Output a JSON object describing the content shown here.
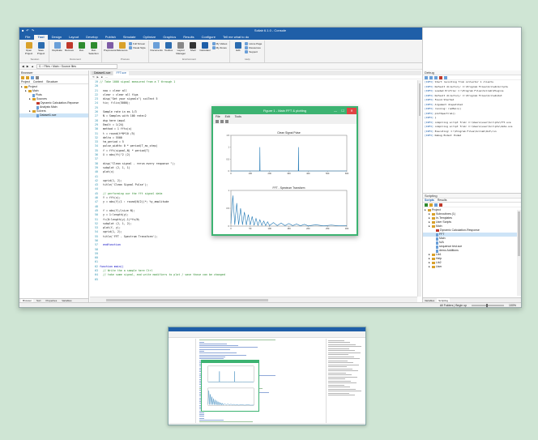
{
  "ide": {
    "title": "Scilab 6.1.0 - Console",
    "quick_access_icons": [
      "save-icon",
      "undo-icon",
      "redo-icon"
    ],
    "window_controls": [
      "—",
      "☐",
      "✕"
    ],
    "menu_tabs": [
      "File",
      "Design",
      "Layout",
      "Develop",
      "Publish",
      "Simulate",
      "Optimize",
      "Graphics",
      "Results",
      "Configure",
      "Tell me what to do"
    ],
    "active_tab": "Tool",
    "account": "Sign in",
    "ribbon": {
      "groups": [
        {
          "label": "Session",
          "buttons": [
            {
              "label": "Open Project",
              "color": "#d9a12b"
            },
            {
              "label": "Save Project",
              "color": "#2b6cb0"
            }
          ]
        },
        {
          "label": "Document",
          "buttons": [
            {
              "label": "Duplicate",
              "color": "#6a9fd8"
            },
            {
              "label": "Remove",
              "color": "#c0392b"
            },
            {
              "label": "Run",
              "color": "#2e8b2e"
            },
            {
              "label": "Run Selection",
              "color": "#2e8b2e"
            }
          ]
        },
        {
          "label": "Process",
          "buttons": [
            {
              "label": "Preprocess",
              "color": "#7d5ba6"
            },
            {
              "label": "Reference",
              "color": "#d9a12b"
            }
          ],
          "small": [
            "Full Screen",
            "Visual Style"
          ]
        },
        {
          "label": "Environment",
          "buttons": [
            {
              "label": "Documents",
              "color": "#6a9fd8"
            },
            {
              "label": "Toolbox",
              "color": "#2b6cb0"
            },
            {
              "label": "Layout Manager",
              "color": "#888888"
            },
            {
              "label": "Shell",
              "color": "#333333"
            },
            {
              "label": "Calculator",
              "color": "#1f5fa8"
            }
          ],
          "small": [
            "My Values",
            "My Zones"
          ]
        },
        {
          "label": "Help",
          "buttons": [
            {
              "label": "Edit",
              "color": "#2b6cb0"
            }
          ],
          "small": [
            "Home Page",
            "Resources",
            "Support"
          ]
        }
      ]
    },
    "address": "C: › Files › Main › Source files",
    "search_placeholder": "Search scripts",
    "browser": {
      "title": "Browser",
      "tabs": [
        "Project",
        "Content",
        "Structure"
      ],
      "tree": [
        {
          "label": "Project",
          "depth": 0,
          "kind": "folder"
        },
        {
          "label": "Main",
          "depth": 1,
          "kind": "folder"
        },
        {
          "label": "Plots",
          "depth": 2,
          "kind": "file"
        },
        {
          "label": "Sources",
          "depth": 2,
          "kind": "folder"
        },
        {
          "label": "Dynamic Calculation-Reponse",
          "depth": 3,
          "kind": "red"
        },
        {
          "label": "Analysis Main",
          "depth": 3,
          "kind": "file"
        },
        {
          "label": "Solvers",
          "depth": 2,
          "kind": "folder"
        },
        {
          "label": "Dataset1.sce",
          "depth": 3,
          "kind": "file",
          "selected": true
        }
      ],
      "bottom_tabs": [
        "Browser",
        "Sort",
        "Properties",
        "Variables"
      ]
    },
    "editor": {
      "tabs": [
        "Dataset1.sce",
        "FFT.sce"
      ],
      "active_tab": "FFT.sce",
      "tools": [
        "⟲",
        "▶",
        "■",
        "⋯"
      ],
      "lines": [
        {
          "n": "19",
          "t": "// Take 1000 signal measured from a T through 1",
          "c": "comment"
        },
        {
          "n": "20",
          "t": "",
          "c": ""
        },
        {
          "n": "21",
          "t": "  now = clear all",
          "c": ""
        },
        {
          "n": "22",
          "t": "  clear = clear all figs",
          "c": ""
        },
        {
          "n": "23",
          "t": "  disp(\"Get your signals\") sciText 5",
          "c": ""
        },
        {
          "n": "24",
          "t": "  tic; f=lin(5000);",
          "c": ""
        },
        {
          "n": "25",
          "t": "",
          "c": ""
        },
        {
          "n": "26",
          "t": "  Sample rate in ms 1/3",
          "c": ""
        },
        {
          "n": "27",
          "t": "  N = Samples with 100 rate=2",
          "c": ""
        },
        {
          "n": "28",
          "t": "  dsp here impul",
          "c": ""
        },
        {
          "n": "29",
          "t": "  Emult = 1(24)",
          "c": ""
        },
        {
          "n": "30",
          "t": "  method = 1 fftx(x)",
          "c": ""
        },
        {
          "n": "31",
          "t": "  t = round(t*N*10 /5)",
          "c": ""
        },
        {
          "n": "32",
          "t": "  delta = 5500",
          "c": ""
        },
        {
          "n": "33",
          "t": "  tm_period = 5",
          "c": ""
        },
        {
          "n": "34",
          "t": "  pulse_width= 0 * period(T_as_step)",
          "c": ""
        },
        {
          "n": "35",
          "t": "  f = fft(signal,N) * period(T)",
          "c": ""
        },
        {
          "n": "36",
          "t": "  X = abs(ft)^2 (2)",
          "c": ""
        },
        {
          "n": "37",
          "t": "",
          "c": ""
        },
        {
          "n": "38",
          "t": "  disp(\"Clean signal - rerun every response \");",
          "c": ""
        },
        {
          "n": "39",
          "t": "  subplot (2, 1, 1)",
          "c": ""
        },
        {
          "n": "40",
          "t": "  plot(x)",
          "c": ""
        },
        {
          "n": "41",
          "t": "",
          "c": ""
        },
        {
          "n": "42",
          "t": "  xgrid(1, 2);",
          "c": ""
        },
        {
          "n": "43",
          "t": "  title('Clean Signal Pulse');",
          "c": ""
        },
        {
          "n": "44",
          "t": "",
          "c": ""
        },
        {
          "n": "45",
          "t": "  // performing our the fft signal data",
          "c": "comment"
        },
        {
          "n": "46",
          "t": "  Y = fft(x);",
          "c": ""
        },
        {
          "n": "47",
          "t": "  y = abs(Y)(1 : round(N/2))*; %y_amplitude",
          "c": ""
        },
        {
          "n": "48",
          "t": "",
          "c": ""
        },
        {
          "n": "49",
          "t": "  f = abs(Y)/(size N);",
          "c": ""
        },
        {
          "n": "50",
          "t": "  y = 1:length(y);",
          "c": ""
        },
        {
          "n": "51",
          "t": "  f=(0:length(y)-1)*fs/N;",
          "c": ""
        },
        {
          "n": "52",
          "t": "  subplot (2, 1, 2);",
          "c": ""
        },
        {
          "n": "53",
          "t": "  plot(f, y);",
          "c": ""
        },
        {
          "n": "54",
          "t": "  xgrid(1, 2);",
          "c": ""
        },
        {
          "n": "55",
          "t": "  title('FFT - Spectrum Transform');",
          "c": ""
        },
        {
          "n": "56",
          "t": "",
          "c": ""
        },
        {
          "n": "57",
          "t": "  endfunction",
          "c": "key"
        },
        {
          "n": "58",
          "t": "",
          "c": ""
        },
        {
          "n": "59",
          "t": "",
          "c": ""
        },
        {
          "n": "60",
          "t": "",
          "c": ""
        },
        {
          "n": "61",
          "t": "",
          "c": ""
        },
        {
          "n": "62",
          "t": "function main()",
          "c": "key"
        },
        {
          "n": "63",
          "t": "  // Write the a sample here Ctrl",
          "c": "comment"
        },
        {
          "n": "64",
          "t": "  // take some signal, and write modifiers to plot / save those can be changed",
          "c": "comment"
        },
        {
          "n": "65",
          "t": "",
          "c": ""
        }
      ]
    },
    "debug": {
      "title": "Debug",
      "lines": [
        {
          "tag": "[INFO]",
          "msg": "Start recording from collector 1 clients"
        },
        {
          "tag": "[INFO]",
          "msg": "Default directory: C:\\Program Files\\Scilab\\Scripts"
        },
        {
          "tag": "[INFO]",
          "msg": "Loaded Profile: C:\\Program Files\\Scilab\\Plugins"
        },
        {
          "tag": "[INFO]",
          "msg": "Default directory: C:\\Program Files\\Scilab\\Out"
        },
        {
          "tag": "[INFO]",
          "msg": "Found Started"
        },
        {
          "tag": "[INFO]",
          "msg": "Argument dispatched"
        },
        {
          "tag": "[INFO]",
          "msg": "running: runMain()"
        },
        {
          "tag": "[INFO]",
          "msg": "   plotSpectrum()"
        },
        {
          "tag": "[INFO]",
          "msg": "}"
        },
        {
          "tag": "[INFO]",
          "msg": "compiling script from: C:\\Users\\user\\Scripts\\fft.sce"
        },
        {
          "tag": "[INFO]",
          "msg": "compiling script from: C:\\Users\\user\\Scripts\\data.sce"
        },
        {
          "tag": "[INFO]",
          "msg": "Executing: C:\\Program Files\\Scilab\\Out\\run"
        },
        {
          "tag": "[INFO]",
          "msg": "Debug Ended: Ended"
        }
      ]
    },
    "scripting": {
      "title": "Scripting",
      "tabs": [
        "Scripts",
        "Results"
      ],
      "tree": [
        {
          "label": "Project",
          "depth": 0,
          "kind": "folder"
        },
        {
          "label": "Subroutines (1)",
          "depth": 1,
          "kind": "folder"
        },
        {
          "label": "In-Templates",
          "depth": 1,
          "kind": "folder"
        },
        {
          "label": "User Scripts",
          "depth": 1,
          "kind": "folder"
        },
        {
          "label": "Main",
          "depth": 1,
          "kind": "folder"
        },
        {
          "label": "Dynamic Calculation-Response",
          "depth": 2,
          "kind": "red"
        },
        {
          "label": "FFT",
          "depth": 2,
          "kind": "file",
          "selected": true
        },
        {
          "label": "Main",
          "depth": 2,
          "kind": "file"
        },
        {
          "label": "N/A",
          "depth": 2,
          "kind": "file"
        },
        {
          "label": "sequence test.sce",
          "depth": 2,
          "kind": "file"
        },
        {
          "label": "demo Additions",
          "depth": 2,
          "kind": "file"
        },
        {
          "label": "Lib1",
          "depth": 1,
          "kind": "folder"
        },
        {
          "label": "Help",
          "depth": 1,
          "kind": "folder"
        },
        {
          "label": "Lib2",
          "depth": 1,
          "kind": "folder"
        },
        {
          "label": "User",
          "depth": 1,
          "kind": "folder"
        }
      ],
      "bottom_tabs": [
        "Variables",
        "Scripting"
      ]
    },
    "status": {
      "text": "All Folders | Begin up",
      "zoom": "100%"
    }
  },
  "figure": {
    "title": "Figure 1 - Main FFT & plotting",
    "menu": [
      "File",
      "Edit",
      "Tools"
    ],
    "plots": [
      {
        "title": "Clean Signal Pulse"
      },
      {
        "title": "FFT - Spectrum Transform"
      }
    ]
  },
  "chart_data": [
    {
      "type": "line",
      "title": "Clean Signal Pulse",
      "xlabel": "",
      "ylabel": "",
      "x": [
        0,
        149,
        150,
        151,
        250,
        251,
        252,
        253,
        349,
        350,
        351,
        352,
        450,
        451,
        452,
        600
      ],
      "y": [
        0,
        0,
        1,
        0,
        0,
        0,
        0,
        0,
        0,
        1,
        0,
        0,
        0,
        0,
        0,
        0
      ],
      "xlim": [
        0,
        600
      ],
      "ylim": [
        0,
        1.5
      ],
      "x_ticks": [
        "0",
        "100",
        "200",
        "300",
        "400",
        "500",
        "600"
      ],
      "y_ticks": [
        "0",
        "0.5",
        "1",
        "1.5"
      ],
      "color": "#1f77b4"
    },
    {
      "type": "line",
      "title": "FFT - Spectrum Transform",
      "xlabel": "",
      "ylabel": "",
      "x": [
        0,
        5,
        10,
        15,
        20,
        25,
        30,
        35,
        40,
        45,
        50,
        55,
        60,
        65,
        70,
        75,
        80,
        85,
        90,
        95,
        100,
        110,
        120,
        130,
        140,
        150,
        160,
        170,
        180,
        190,
        200,
        220,
        240,
        260,
        280,
        300
      ],
      "y": [
        0.1,
        1.2,
        0.05,
        0.9,
        0.05,
        0.7,
        0.05,
        0.55,
        0.04,
        0.45,
        0.04,
        0.38,
        0.03,
        0.3,
        0.03,
        0.25,
        0.03,
        0.2,
        0.02,
        0.17,
        0.02,
        0.14,
        0.02,
        0.12,
        0.02,
        0.1,
        0.02,
        0.08,
        0.01,
        0.07,
        0.01,
        0.05,
        0.01,
        0.04,
        0.01,
        0.02
      ],
      "xlim": [
        0,
        300
      ],
      "ylim": [
        0,
        1.4
      ],
      "x_ticks": [
        "0",
        "50",
        "100",
        "150",
        "200",
        "250",
        "300"
      ],
      "y_ticks": [
        "0",
        "0.5",
        "1"
      ],
      "color": "#1f77b4"
    }
  ]
}
